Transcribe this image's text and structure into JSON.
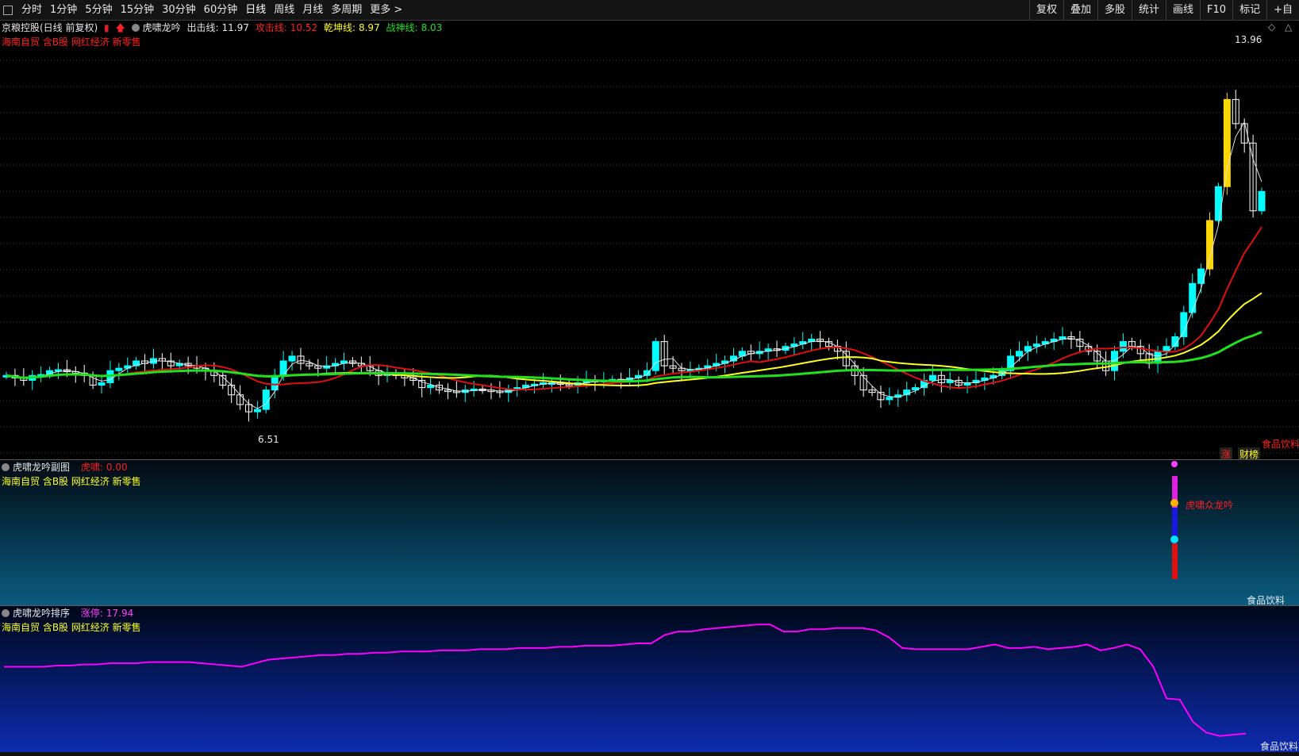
{
  "toolbar": {
    "periods": [
      "分时",
      "1分钟",
      "5分钟",
      "15分钟",
      "30分钟",
      "60分钟",
      "日线",
      "周线",
      "月线",
      "多周期",
      "更多 >"
    ],
    "active_period": "日线",
    "right_buttons": [
      "复权",
      "叠加",
      "多股",
      "统计",
      "画线",
      "F10",
      "标记",
      "+自"
    ]
  },
  "main": {
    "stock_title": "京粮控股(日线 前复权)",
    "indicator_name": "虎啸龙吟",
    "lines": [
      {
        "label": "出击线:",
        "value": "11.97",
        "color": "#e8e8e8"
      },
      {
        "label": "攻击线:",
        "value": "10.52",
        "color": "#ff2020"
      },
      {
        "label": "乾坤线:",
        "value": "8.97",
        "color": "#ffff20"
      },
      {
        "label": "战神线:",
        "value": "8.03",
        "color": "#20e020"
      }
    ],
    "concepts": "海南自贸 含B股 网红经济 新零售",
    "high_label": "13.96",
    "low_label": "6.51",
    "sector": "食品饮料",
    "badge_zhang": "涨",
    "badge_caibang": "财榜"
  },
  "sub1": {
    "title": "虎啸龙吟副图",
    "value_label": "虎啸:",
    "value": "0.00",
    "concepts": "海南自贸 含B股 网红经济 新零售",
    "signal_text": "虎啸众龙吟",
    "sector": "食品饮料"
  },
  "sub2": {
    "title": "虎啸龙吟排序",
    "value_label": "涨停:",
    "value": "17.94",
    "concepts": "海南自贸 含B股 网红经济 新零售",
    "sector": "食品饮料"
  },
  "colors": {
    "up": "#00ffff",
    "limit": "#ffd700",
    "ma_white": "#e0e0e0",
    "ma_red": "#e01010",
    "ma_yellow": "#ffff20",
    "ma_green": "#20e020",
    "rank_line": "#ff00ff"
  },
  "chart_data": {
    "type": "candlestick",
    "price_range": [
      6.0,
      14.6
    ],
    "closes": [
      7.6,
      7.55,
      7.5,
      7.6,
      7.62,
      7.7,
      7.72,
      7.68,
      7.65,
      7.6,
      7.4,
      7.45,
      7.7,
      7.75,
      7.8,
      7.9,
      7.85,
      7.95,
      7.9,
      7.8,
      7.85,
      7.8,
      7.75,
      7.7,
      7.6,
      7.4,
      7.2,
      7.0,
      6.85,
      6.9,
      7.3,
      7.6,
      7.9,
      8.0,
      7.85,
      7.8,
      7.75,
      7.8,
      7.85,
      7.9,
      7.85,
      7.8,
      7.7,
      7.6,
      7.65,
      7.6,
      7.55,
      7.5,
      7.35,
      7.4,
      7.3,
      7.28,
      7.25,
      7.3,
      7.32,
      7.3,
      7.28,
      7.25,
      7.3,
      7.35,
      7.4,
      7.42,
      7.45,
      7.45,
      7.42,
      7.4,
      7.45,
      7.5,
      7.48,
      7.5,
      7.52,
      7.5,
      7.55,
      7.6,
      7.7,
      8.3,
      7.8,
      7.75,
      7.7,
      7.72,
      7.75,
      7.8,
      7.85,
      7.9,
      8.0,
      8.1,
      8.05,
      8.1,
      8.15,
      8.12,
      8.2,
      8.25,
      8.3,
      8.35,
      8.3,
      8.2,
      8.1,
      7.8,
      7.6,
      7.3,
      7.25,
      7.1,
      7.15,
      7.2,
      7.3,
      7.35,
      7.5,
      7.6,
      7.45,
      7.5,
      7.4,
      7.45,
      7.5,
      7.55,
      7.6,
      7.7,
      8.0,
      8.1,
      8.2,
      8.25,
      8.3,
      8.35,
      8.4,
      8.35,
      8.2,
      8.1,
      7.9,
      7.7,
      8.1,
      8.3,
      8.2,
      8.05,
      7.85,
      8.1,
      8.2,
      8.4,
      8.9,
      9.5,
      9.8,
      10.8,
      11.5,
      13.3,
      12.8,
      12.4,
      11.0,
      11.4
    ]
  },
  "rank_data": {
    "type": "line",
    "values": [
      17.0,
      17.0,
      17.0,
      17.0,
      17.1,
      17.1,
      17.2,
      17.2,
      17.3,
      17.3,
      17.3,
      17.4,
      17.4,
      17.4,
      17.4,
      17.3,
      17.2,
      17.1,
      17.0,
      17.3,
      17.6,
      17.7,
      17.8,
      17.9,
      18.0,
      18.0,
      18.1,
      18.1,
      18.2,
      18.2,
      18.3,
      18.3,
      18.3,
      18.4,
      18.4,
      18.4,
      18.5,
      18.5,
      18.5,
      18.6,
      18.6,
      18.6,
      18.7,
      18.7,
      18.8,
      18.8,
      18.8,
      18.9,
      19.0,
      19.0,
      19.7,
      20.0,
      20.0,
      20.2,
      20.3,
      20.4,
      20.5,
      20.6,
      20.6,
      20.0,
      20.0,
      20.2,
      20.2,
      20.3,
      20.3,
      20.3,
      20.1,
      19.5,
      18.6,
      18.5,
      18.5,
      18.5,
      18.5,
      18.5,
      18.7,
      18.9,
      18.6,
      18.6,
      18.7,
      18.5,
      18.6,
      18.7,
      18.9,
      18.4,
      18.6,
      18.9,
      18.5,
      17.0,
      14.3,
      14.2,
      12.3,
      11.4,
      11.1,
      11.2,
      11.3
    ]
  }
}
